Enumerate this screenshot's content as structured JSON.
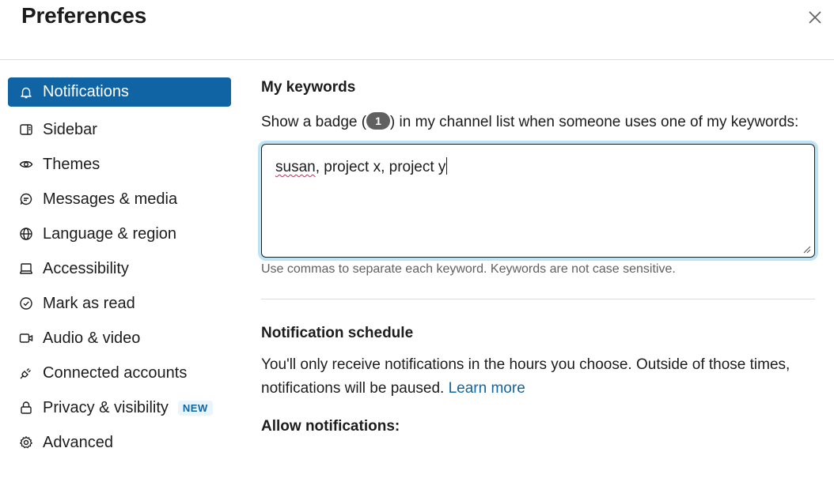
{
  "header": {
    "title": "Preferences",
    "close_icon": "close-icon"
  },
  "sidebar": {
    "items": [
      {
        "label": "Notifications",
        "icon": "bell-icon",
        "active": true
      },
      {
        "label": "Sidebar",
        "icon": "sidebar-icon"
      },
      {
        "label": "Themes",
        "icon": "eye-icon"
      },
      {
        "label": "Messages & media",
        "icon": "message-icon"
      },
      {
        "label": "Language & region",
        "icon": "globe-icon"
      },
      {
        "label": "Accessibility",
        "icon": "laptop-icon"
      },
      {
        "label": "Mark as read",
        "icon": "check-circle-icon"
      },
      {
        "label": "Audio & video",
        "icon": "video-icon"
      },
      {
        "label": "Connected accounts",
        "icon": "plug-icon"
      },
      {
        "label": "Privacy & visibility",
        "icon": "lock-icon",
        "badge": "NEW"
      },
      {
        "label": "Advanced",
        "icon": "gear-icon"
      }
    ]
  },
  "keywords": {
    "title": "My keywords",
    "desc_before": "Show a badge (",
    "badge_count": "1",
    "desc_after": ") in my channel list when someone uses one of my keywords:",
    "value_first": "susan",
    "value_rest": ", project x, project y",
    "hint": "Use commas to separate each keyword. Keywords are not case sensitive."
  },
  "schedule": {
    "title": "Notification schedule",
    "desc": "You'll only receive notifications in the hours you choose. Outside of those times, notifications will be paused.",
    "learn_more": "Learn more",
    "allow_label": "Allow notifications:"
  },
  "colors": {
    "accent": "#1164a3",
    "link": "#1264a3",
    "focus_ring": "#bde3f5"
  }
}
